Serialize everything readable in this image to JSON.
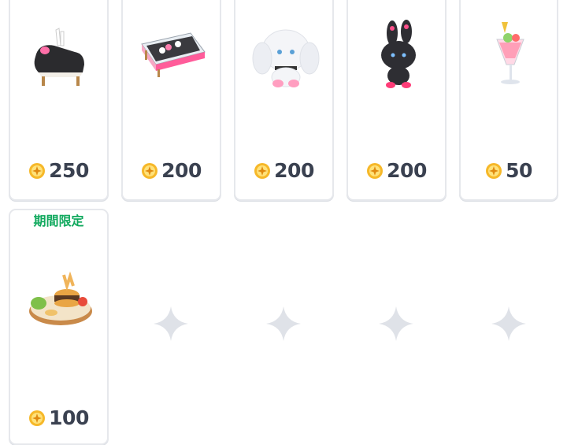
{
  "shop": {
    "items": [
      {
        "name": "black bunny chaise sofa",
        "price": "250",
        "icon": "chaise-sofa-item-icon"
      },
      {
        "name": "pink daybed with pillows",
        "price": "200",
        "icon": "daybed-item-icon"
      },
      {
        "name": "white bunny plush",
        "price": "200",
        "icon": "white-bunny-plush-item-icon"
      },
      {
        "name": "black bunny plush",
        "price": "200",
        "icon": "black-bunny-plush-item-icon"
      },
      {
        "name": "bunny cocktail glass",
        "price": "50",
        "icon": "cocktail-item-icon"
      },
      {
        "name": "burger platter",
        "price": "100",
        "icon": "burger-platter-item-icon",
        "badge": "期間限定"
      }
    ],
    "empty_slots": 4,
    "currency_icon": "gold-coin-icon",
    "colors": {
      "limited_badge": "#11a95e",
      "price_text": "#3a4150",
      "card_border": "#e6e8ec"
    }
  }
}
